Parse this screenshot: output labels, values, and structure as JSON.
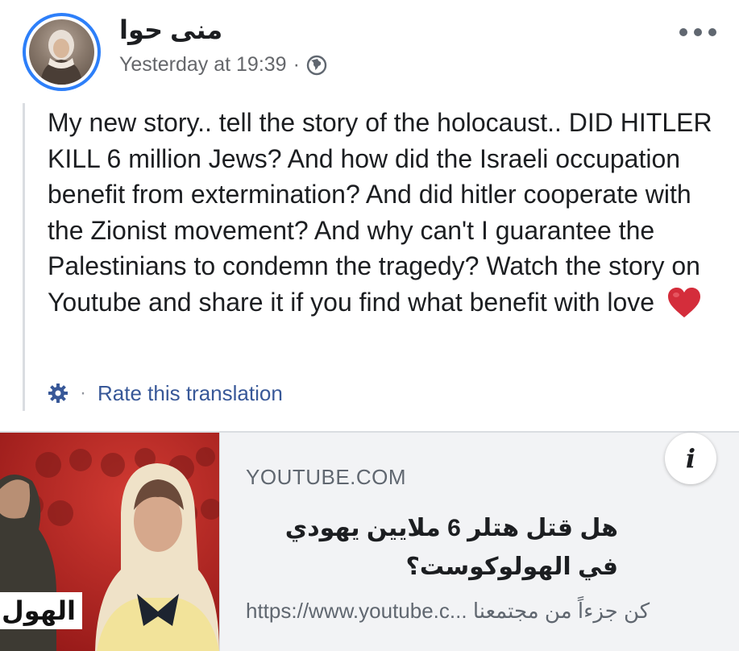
{
  "post": {
    "author_name": "منى حوا",
    "timestamp": "Yesterday at 19:39",
    "separator": "·",
    "privacy_icon": "globe-icon",
    "more_icon": "more-dots-icon",
    "text": "My new story.. tell the story of the holocaust.. DID HITLER KILL 6 million Jews? And how did the Israeli occupation benefit from extermination? And did hitler cooperate with the Zionist movement? And why can't I guarantee the Palestinians to condemn the tragedy? Watch the story on Youtube and share it if you find what benefit with love",
    "emoji_icon": "red-heart-icon",
    "translation": {
      "icon": "gear-icon",
      "separator": "·",
      "label": "Rate this translation"
    }
  },
  "link_preview": {
    "domain": "YOUTUBE.COM",
    "title": "هل قتل هتلر 6 ملايين يهودي في الهولوكوست؟",
    "description": "https://www.youtube.c... كن جزءاً من مجتمعنا",
    "info_label": "i",
    "thumbnail_caption": "الهول"
  },
  "colors": {
    "avatar_ring": "#2d7ff9",
    "link_blue": "#385898",
    "secondary_text": "#65676b",
    "heart": "#d42d3b",
    "thumbnail_red": "#b52121"
  }
}
